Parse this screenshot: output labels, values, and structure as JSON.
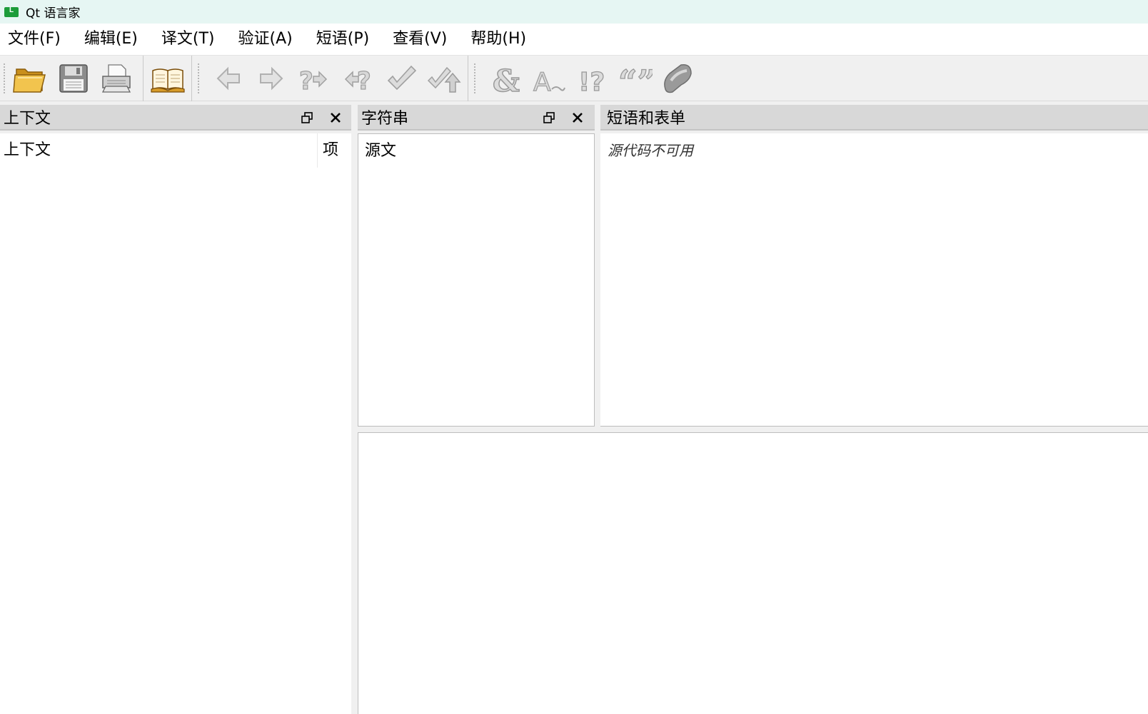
{
  "window": {
    "title": "Qt 语言家"
  },
  "menu": [
    {
      "label": "文件(F)"
    },
    {
      "label": "编辑(E)"
    },
    {
      "label": "译文(T)"
    },
    {
      "label": "验证(A)"
    },
    {
      "label": "短语(P)"
    },
    {
      "label": "查看(V)"
    },
    {
      "label": "帮助(H)"
    }
  ],
  "toolbar": {
    "icons": [
      "open-folder-icon",
      "save-icon",
      "print-icon",
      "open-phrasebook-icon",
      "previous-icon",
      "next-icon",
      "previous-unfinished-icon",
      "next-unfinished-icon",
      "done-icon",
      "done-and-next-icon",
      "accelerators-icon",
      "ending-punctuation-icon",
      "phrase-matches-icon",
      "place-markers-icon",
      "surrounding-whitespace-icon"
    ]
  },
  "context_dock": {
    "title": "上下文",
    "columns": [
      "上下文",
      "项"
    ]
  },
  "strings_dock": {
    "title": "字符串",
    "columns": [
      "源文"
    ]
  },
  "phrases_dock": {
    "title": "短语和表单",
    "message": "源代码不可用"
  },
  "colors": {
    "titlebar_bg": "#e6f6f3",
    "app_icon": "#1c9c3a",
    "folder": "#e8b431",
    "disabled_icon": "#a9a9a9"
  }
}
